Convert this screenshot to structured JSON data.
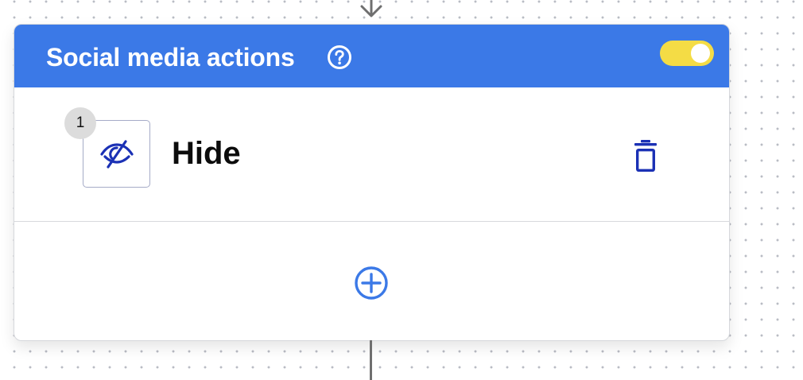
{
  "card": {
    "title": "Social media actions",
    "header_color": "#3b79e7",
    "enabled": true,
    "toggle_color": "#f4dc45",
    "help_icon": "question-circle-icon"
  },
  "actions": [
    {
      "step": "1",
      "label": "Hide",
      "icon": "eye-slash-icon",
      "delete_icon": "trash-icon"
    }
  ],
  "add_action_icon": "plus-circle-icon",
  "accent_colors": {
    "icon_blue": "#1b31b5",
    "add_blue": "#3b79e7"
  }
}
